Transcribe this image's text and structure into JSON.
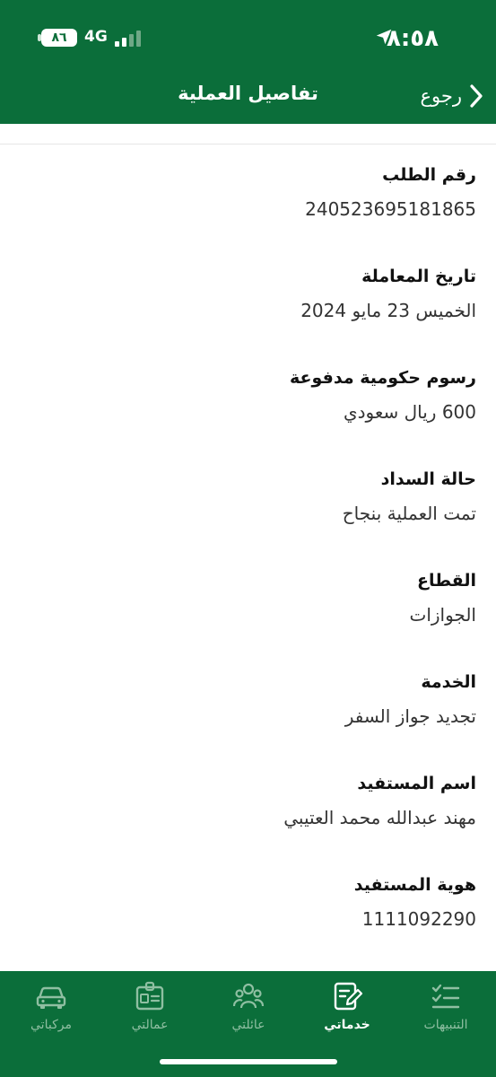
{
  "status_bar": {
    "time": "٨:٥٨",
    "network": "4G",
    "battery": "٨٦"
  },
  "header": {
    "title": "تفاصيل العملية",
    "back_label": "رجوع"
  },
  "details": [
    {
      "label": "رقم الطلب",
      "value": "240523695181865"
    },
    {
      "label": "تاريخ المعاملة",
      "value": "الخميس 23 مايو 2024"
    },
    {
      "label": "رسوم حكومية مدفوعة",
      "value": "600 ريال سعودي"
    },
    {
      "label": "حالة السداد",
      "value": "تمت العملية بنجاح"
    },
    {
      "label": "القطاع",
      "value": "الجوازات"
    },
    {
      "label": "الخدمة",
      "value": "تجديد جواز السفر"
    },
    {
      "label": "اسم المستفيد",
      "value": "مهند عبدالله محمد العتيبي"
    },
    {
      "label": "هوية المستفيد",
      "value": "1111092290"
    }
  ],
  "tabs": [
    {
      "label": "التنبيهات",
      "icon": "checklist-icon",
      "active": false
    },
    {
      "label": "خدماتي",
      "icon": "edit-document-icon",
      "active": true
    },
    {
      "label": "عائلتي",
      "icon": "family-icon",
      "active": false
    },
    {
      "label": "عمالتي",
      "icon": "id-badge-icon",
      "active": false
    },
    {
      "label": "مركباتي",
      "icon": "car-icon",
      "active": false
    }
  ],
  "colors": {
    "brand_green": "#0b6e3a",
    "inactive_tab": "#8fbfa2"
  }
}
